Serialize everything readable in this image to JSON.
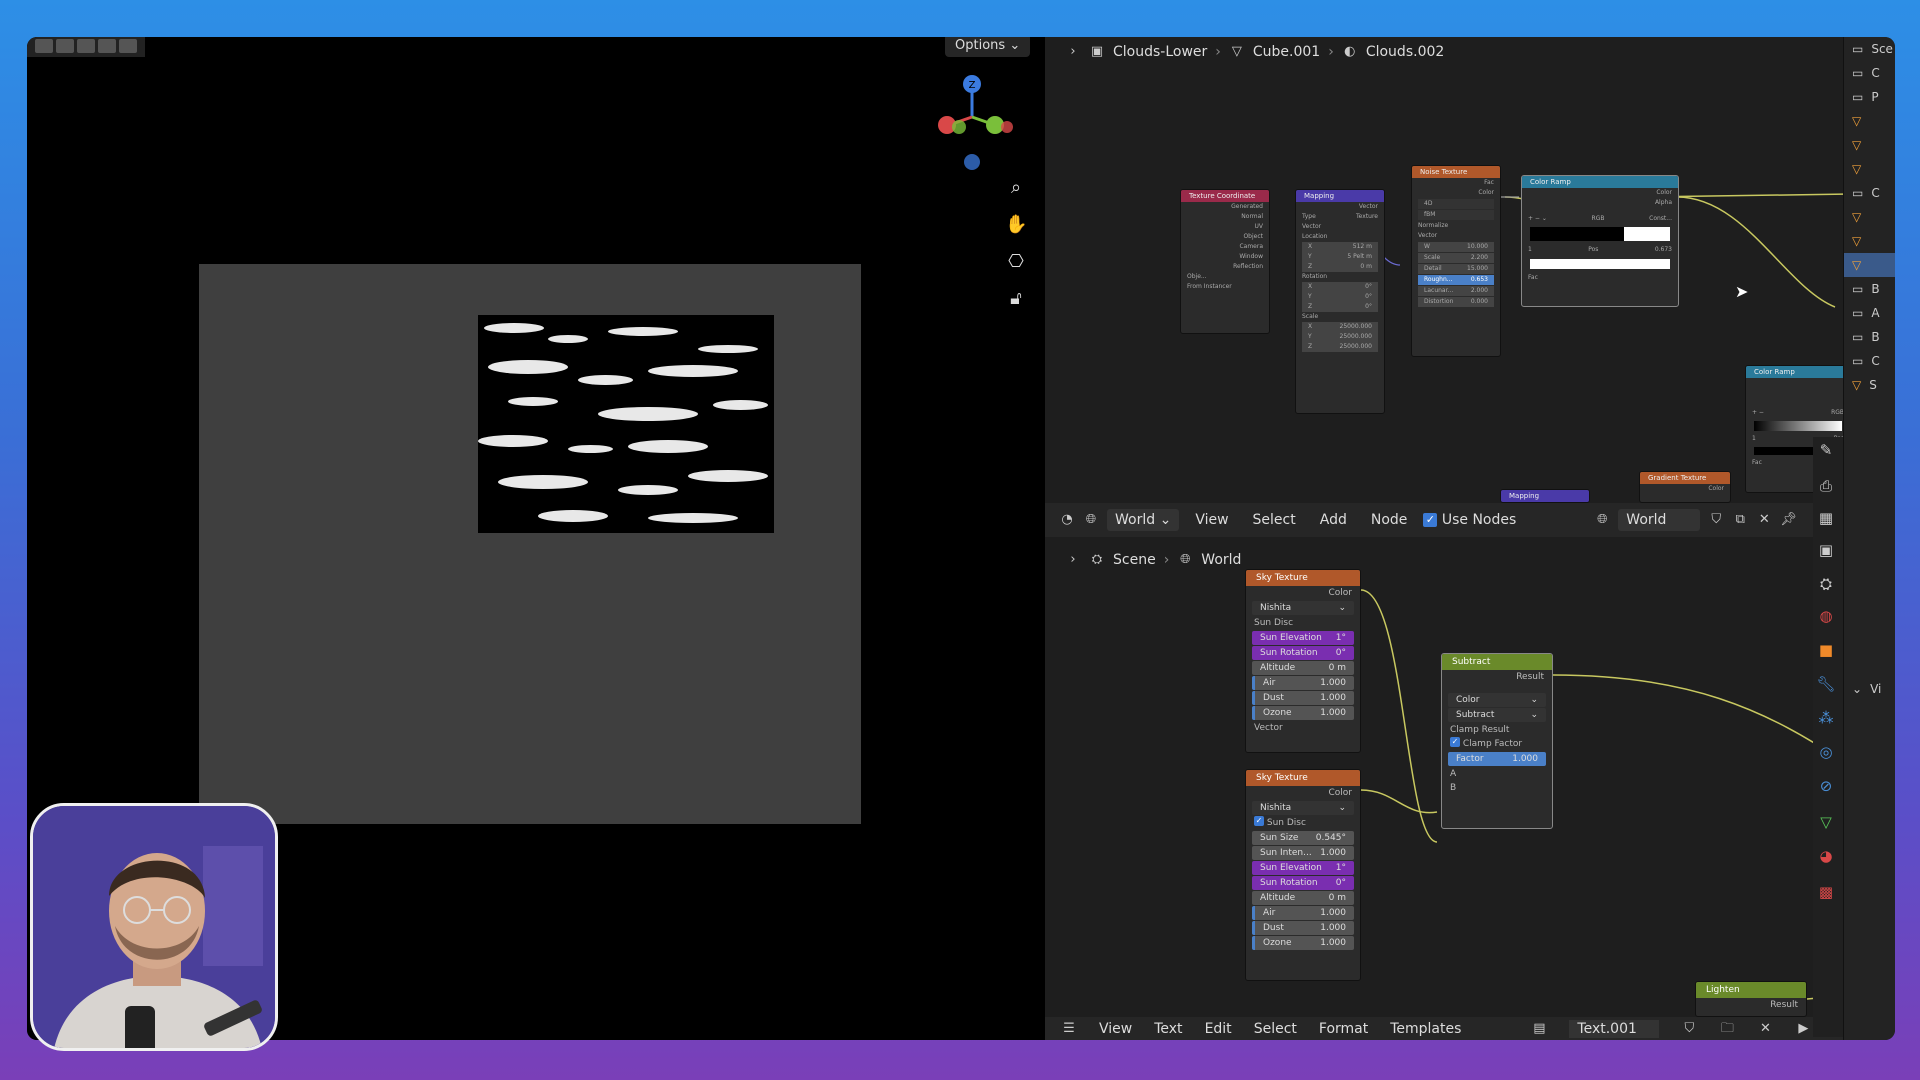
{
  "viewport": {
    "options_label": "Options",
    "options_chevron": "chevron-down-icon",
    "axes": {
      "z": "Z"
    }
  },
  "top_editor": {
    "breadcrumb": [
      {
        "icon": "object-icon",
        "label": "Clouds-Lower"
      },
      {
        "icon": "mesh-icon",
        "label": "Cube.001"
      },
      {
        "icon": "material-icon",
        "label": "Clouds.002"
      }
    ],
    "nodes": {
      "tex_coord": {
        "title": "Texture Coordinate",
        "outputs": [
          "Generated",
          "Normal",
          "UV",
          "Object",
          "Camera",
          "Window",
          "Reflection"
        ],
        "object_label": "Obje...",
        "from_instancer": "From Instancer"
      },
      "mapping": {
        "title": "Mapping",
        "output": "Vector",
        "type_label": "Type",
        "type_value": "Texture",
        "vector": "Vector",
        "location": "Location",
        "loc": [
          {
            "k": "X",
            "v": "512 m"
          },
          {
            "k": "Y",
            "v": "5 Pelt m"
          },
          {
            "k": "Z",
            "v": "0 m"
          }
        ],
        "rotation": "Rotation",
        "rot": [
          {
            "k": "X",
            "v": "0°"
          },
          {
            "k": "Y",
            "v": "0°"
          },
          {
            "k": "Z",
            "v": "0°"
          }
        ],
        "scale": "Scale",
        "scl": [
          {
            "k": "X",
            "v": "25000.000"
          },
          {
            "k": "Y",
            "v": "25000.000"
          },
          {
            "k": "Z",
            "v": "25000.000"
          }
        ]
      },
      "noise": {
        "title": "Noise Texture",
        "outputs": [
          "Fac",
          "Color"
        ],
        "dim": "4D",
        "basis": "fBM",
        "normalize": "Normalize",
        "vector": "Vector",
        "fields": [
          {
            "k": "W",
            "v": "10.000"
          },
          {
            "k": "Scale",
            "v": "2.200"
          },
          {
            "k": "Detail",
            "v": "15.000"
          },
          {
            "k": "Roughn...",
            "v": "0.653"
          },
          {
            "k": "Lacunar...",
            "v": "2.000"
          },
          {
            "k": "Distortion",
            "v": "0.000"
          }
        ]
      },
      "color_ramp": {
        "title": "Color Ramp",
        "outputs": [
          "Color",
          "Alpha"
        ],
        "mode": "RGB",
        "interp": "Const...",
        "idx": "1",
        "pos_label": "Pos",
        "pos_value": "0.673",
        "fac": "Fac"
      },
      "color_ramp2": {
        "title": "Color Ramp",
        "mode": "RGB",
        "idx": "1",
        "pos_label": "Pos",
        "fac": "Fac"
      },
      "gradient": {
        "title": "Gradient Texture",
        "out": "Color"
      },
      "mapping2": {
        "title": "Mapping"
      }
    }
  },
  "node_header": {
    "editor_icon": "editor-type-icon",
    "world_type_icon": "world-icon",
    "type_label": "World",
    "menus": [
      "View",
      "Select",
      "Add",
      "Node"
    ],
    "use_nodes_label": "Use Nodes",
    "world_field": "World"
  },
  "bottom_editor": {
    "breadcrumb": [
      {
        "icon": "scene-icon",
        "label": "Scene"
      },
      {
        "icon": "world-icon",
        "label": "World"
      }
    ],
    "sky1": {
      "title": "Sky Texture",
      "out": "Color",
      "type": "Nishita",
      "sun_disc": "Sun Disc",
      "sun_elev": {
        "k": "Sun Elevation",
        "v": "1°"
      },
      "sun_rot": {
        "k": "Sun Rotation",
        "v": "0°"
      },
      "alt": {
        "k": "Altitude",
        "v": "0 m"
      },
      "air": {
        "k": "Air",
        "v": "1.000"
      },
      "dust": {
        "k": "Dust",
        "v": "1.000"
      },
      "ozone": {
        "k": "Ozone",
        "v": "1.000"
      },
      "vector": "Vector"
    },
    "sky2": {
      "title": "Sky Texture",
      "out": "Color",
      "type": "Nishita",
      "sun_disc": "Sun Disc",
      "sun_size": {
        "k": "Sun Size",
        "v": "0.545°"
      },
      "sun_int": {
        "k": "Sun Inten...",
        "v": "1.000"
      },
      "sun_elev": {
        "k": "Sun Elevation",
        "v": "1°"
      },
      "sun_rot": {
        "k": "Sun Rotation",
        "v": "0°"
      },
      "alt": {
        "k": "Altitude",
        "v": "0 m"
      },
      "air": {
        "k": "Air",
        "v": "1.000"
      },
      "dust": {
        "k": "Dust",
        "v": "1.000"
      },
      "ozone": {
        "k": "Ozone",
        "v": "1.000"
      }
    },
    "subtract": {
      "title": "Subtract",
      "out": "Result",
      "type": "Color",
      "op": "Subtract",
      "clamp_result": "Clamp Result",
      "clamp_factor": "Clamp Factor",
      "factor": {
        "k": "Factor",
        "v": "1.000"
      },
      "a": "A",
      "b": "B"
    },
    "lighten": {
      "title": "Lighten",
      "out": "Result"
    }
  },
  "text_header": {
    "editor_icon": "text-editor-icon",
    "menus": [
      "View",
      "Text",
      "Edit",
      "Select",
      "Format",
      "Templates"
    ],
    "file": "Text.001"
  },
  "outliner": {
    "rows": [
      "Sce",
      "C",
      "P",
      "",
      "",
      "",
      "C",
      "",
      "",
      "",
      "B",
      "A",
      "B",
      "C",
      "S",
      ""
    ],
    "vi": "Vi"
  },
  "colors": {
    "accent": "#3a7ad6",
    "purple": "#7a2eb0",
    "node_wire": "#c8c860"
  }
}
